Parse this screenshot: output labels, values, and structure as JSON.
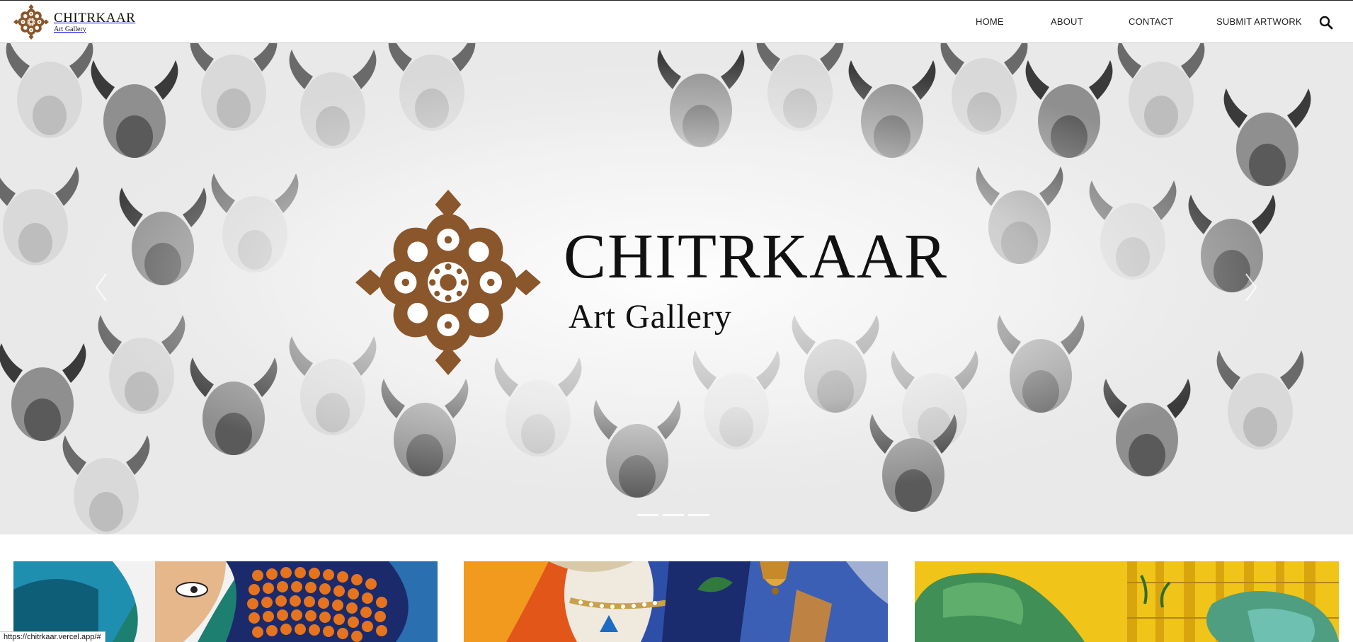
{
  "header": {
    "brand_name": "CHITRKAAR",
    "brand_sub": "Art Gallery",
    "nav": {
      "home": "HOME",
      "about": "ABOUT",
      "contact": "CONTACT",
      "submit": "SUBMIT ARTWORK"
    },
    "search_icon": "search-icon"
  },
  "hero": {
    "title": "CHITRKAAR",
    "subtitle": "Art Gallery",
    "prev_icon": "chevron-left-icon",
    "next_icon": "chevron-right-icon",
    "slide_count": 3
  },
  "colors": {
    "brand_brown": "#8a562b",
    "text": "#111111"
  },
  "gallery": {
    "cards": [
      {
        "name": "artwork-card-1"
      },
      {
        "name": "artwork-card-2"
      },
      {
        "name": "artwork-card-3"
      }
    ]
  },
  "status": {
    "url": "https://chitrkaar.vercel.app/#"
  }
}
